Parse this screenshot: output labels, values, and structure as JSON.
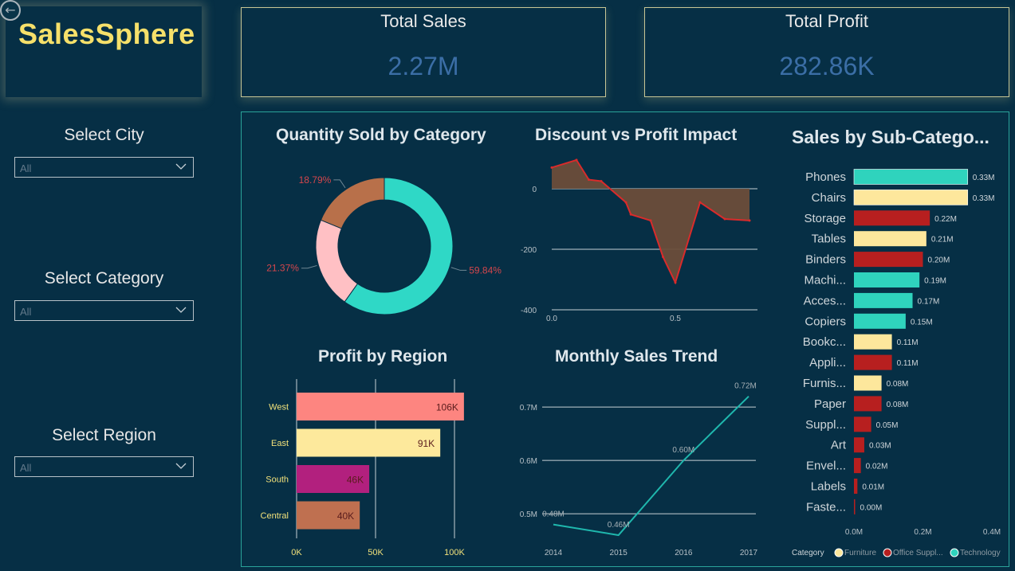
{
  "app": {
    "back_icon": "arrow-left-circle-icon",
    "logo": "SalesSphere"
  },
  "kpis": {
    "total_sales": {
      "title": "Total Sales",
      "value": "2.27M"
    },
    "total_profit": {
      "title": "Total Profit",
      "value": "282.86K"
    }
  },
  "slicers": {
    "city": {
      "label": "Select City",
      "value": "All"
    },
    "category": {
      "label": "Select Category",
      "value": "All"
    },
    "region": {
      "label": "Select Region",
      "value": "All"
    }
  },
  "colors": {
    "background": "#062f45",
    "accent_yellow": "#f6e06a",
    "technology": "#2fd3bd",
    "furniture": "#fde79c",
    "office_supplies": "#b71f1f",
    "kpi_value": "#3b6ea6"
  },
  "chart_data": [
    {
      "id": "donut",
      "type": "pie",
      "title": "Quantity Sold by Category",
      "slices": [
        {
          "label": "59.84%",
          "value": 59.84,
          "color": "#2fd8c6"
        },
        {
          "label": "21.37%",
          "value": 21.37,
          "color": "#ffc0c4"
        },
        {
          "label": "18.79%",
          "value": 18.79,
          "color": "#b8704a"
        }
      ]
    },
    {
      "id": "discount",
      "type": "area",
      "title": "Discount vs Profit Impact",
      "x": [
        0.0,
        0.1,
        0.15,
        0.2,
        0.3,
        0.32,
        0.4,
        0.45,
        0.5,
        0.6,
        0.7,
        0.8
      ],
      "y": [
        70,
        95,
        30,
        25,
        -45,
        -85,
        -105,
        -225,
        -310,
        -45,
        -100,
        -105
      ],
      "ylim": [
        -400,
        100
      ],
      "xlim": [
        0.0,
        0.8
      ],
      "yticks": [
        "0",
        "-200",
        "-400"
      ],
      "xticks": [
        "0.0",
        "0.5"
      ]
    },
    {
      "id": "sub",
      "type": "bar",
      "title": "Sales by Sub-Catego...",
      "categories": [
        "Phones",
        "Chairs",
        "Storage",
        "Tables",
        "Binders",
        "Machi...",
        "Acces...",
        "Copiers",
        "Bookc...",
        "Appli...",
        "Furnis...",
        "Paper",
        "Suppl...",
        "Art",
        "Envel...",
        "Labels",
        "Faste..."
      ],
      "values": [
        0.33,
        0.33,
        0.22,
        0.21,
        0.2,
        0.19,
        0.17,
        0.15,
        0.11,
        0.11,
        0.08,
        0.08,
        0.05,
        0.03,
        0.02,
        0.01,
        0.0
      ],
      "value_labels": [
        "0.33M",
        "0.33M",
        "0.22M",
        "0.21M",
        "0.20M",
        "0.19M",
        "0.17M",
        "0.15M",
        "0.11M",
        "0.11M",
        "0.08M",
        "0.08M",
        "0.05M",
        "0.03M",
        "0.02M",
        "0.01M",
        "0.00M"
      ],
      "groups": [
        "Technology",
        "Furniture",
        "Office Supplies",
        "Furniture",
        "Office Supplies",
        "Technology",
        "Technology",
        "Technology",
        "Furniture",
        "Office Supplies",
        "Furniture",
        "Office Supplies",
        "Office Supplies",
        "Office Supplies",
        "Office Supplies",
        "Office Supplies",
        "Office Supplies"
      ],
      "xlim": [
        0,
        0.4
      ],
      "xticks": [
        "0.0M",
        "0.2M",
        "0.4M"
      ],
      "legend": {
        "title": "Category",
        "items": [
          {
            "name": "Furniture",
            "color": "#fde79c"
          },
          {
            "name": "Office Suppl...",
            "color": "#b71f1f"
          },
          {
            "name": "Technology",
            "color": "#2fd3bd"
          }
        ]
      }
    },
    {
      "id": "region",
      "type": "bar",
      "title": "Profit by Region",
      "categories": [
        "West",
        "East",
        "South",
        "Central"
      ],
      "values": [
        106,
        91,
        46,
        40
      ],
      "value_labels": [
        "106K",
        "91K",
        "46K",
        "40K"
      ],
      "colors": [
        "#fd8580",
        "#fde99c",
        "#b2207e",
        "#bf7050"
      ],
      "xlim": [
        0,
        100
      ],
      "xticks": [
        "0K",
        "50K",
        "100K"
      ]
    },
    {
      "id": "monthly",
      "type": "line",
      "title": "Monthly Sales Trend",
      "x": [
        "2014",
        "2015",
        "2016",
        "2017"
      ],
      "y": [
        0.48,
        0.46,
        0.6,
        0.72
      ],
      "value_labels": [
        "0.48M",
        "0.46M",
        "0.60M",
        "0.72M"
      ],
      "ylim": [
        0.46,
        0.73
      ],
      "yticks": [
        {
          "value": 0.5,
          "label": "0.5M"
        },
        {
          "value": 0.6,
          "label": "0.6M"
        },
        {
          "value": 0.7,
          "label": "0.7M"
        }
      ]
    }
  ]
}
